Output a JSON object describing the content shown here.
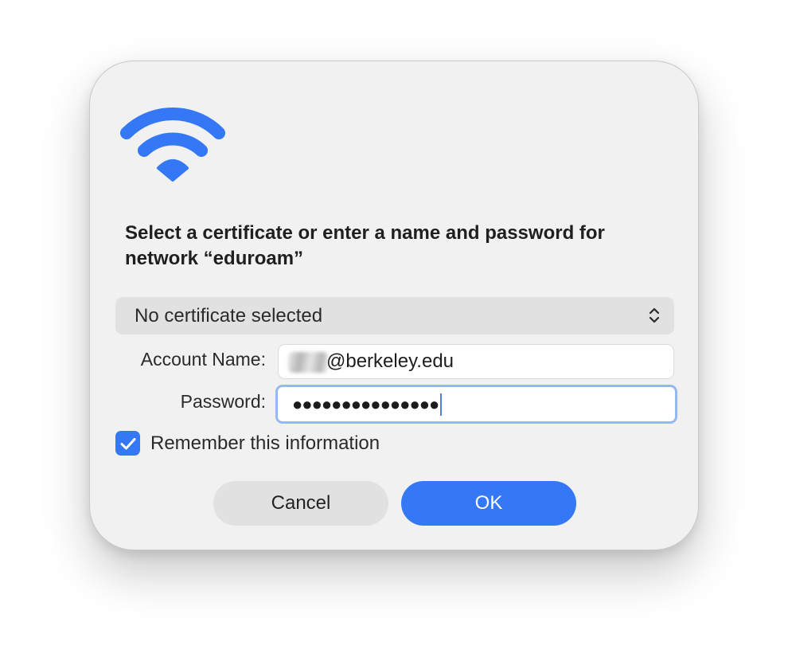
{
  "dialog": {
    "title": "Select a certificate or enter a name and password for network “eduroam”",
    "icon": "wifi-icon"
  },
  "certificate": {
    "selected": "No certificate selected",
    "icon": "chevron-up-down-icon"
  },
  "account": {
    "label": "Account Name:",
    "value": "@berkeley.edu",
    "prefix_redacted": true
  },
  "password": {
    "label": "Password:",
    "masked_value": "●●●●●●●●●●●●●●●"
  },
  "remember": {
    "label": "Remember this information",
    "checked": true
  },
  "buttons": {
    "cancel_label": "Cancel",
    "ok_label": "OK"
  },
  "colors": {
    "accent": "#3478f6",
    "dialog_bg": "#f1f1f1",
    "focus_ring": "#95b7f2"
  }
}
